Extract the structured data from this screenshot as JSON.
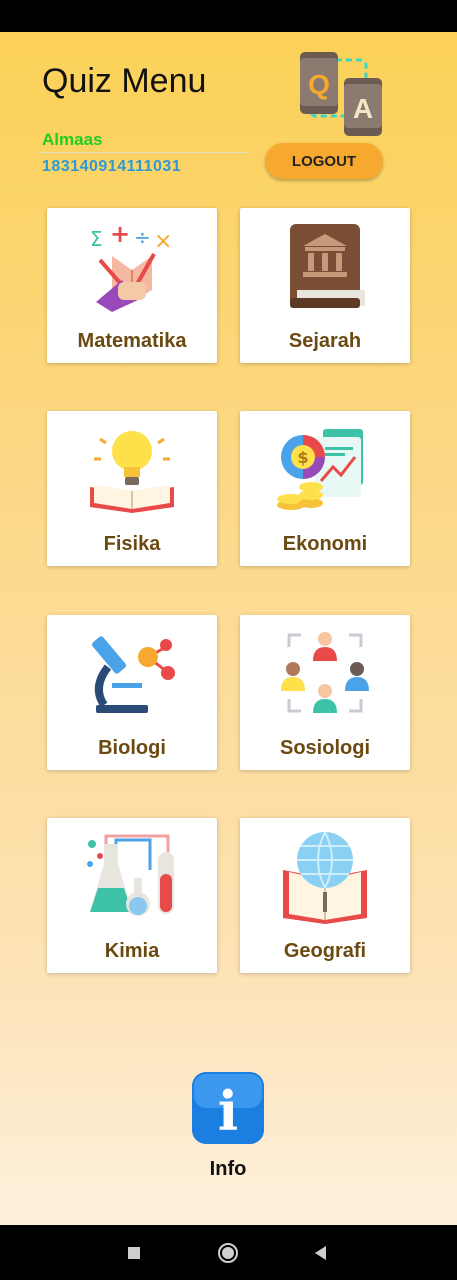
{
  "header": {
    "title": "Quiz Menu",
    "user_name": "Almaas",
    "user_id": "183140914111031",
    "logout_label": "LOGOUT",
    "logo_letters": [
      "Q",
      "A"
    ]
  },
  "subjects": [
    {
      "label": "Matematika",
      "icon": "math-icon"
    },
    {
      "label": "Sejarah",
      "icon": "history-book-icon"
    },
    {
      "label": "Fisika",
      "icon": "lightbulb-book-icon"
    },
    {
      "label": "Ekonomi",
      "icon": "economy-chart-icon"
    },
    {
      "label": "Biologi",
      "icon": "microscope-icon"
    },
    {
      "label": "Sosiologi",
      "icon": "people-group-icon"
    },
    {
      "label": "Kimia",
      "icon": "chemistry-flask-icon"
    },
    {
      "label": "Geografi",
      "icon": "globe-book-icon"
    }
  ],
  "footer": {
    "info_label": "Info",
    "info_glyph": "i"
  },
  "colors": {
    "accent": "#f6a92e",
    "username": "#22cc22",
    "userid": "#2d9ad8",
    "label": "#6b4a12",
    "info_blue": "#1a7fe0"
  }
}
